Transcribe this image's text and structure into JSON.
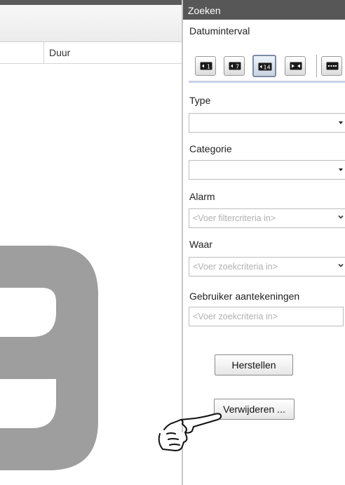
{
  "results_table": {
    "columns": [
      "Duur"
    ]
  },
  "search_panel": {
    "title": "Zoeken",
    "date_interval": {
      "label": "Datuminterval",
      "buttons": [
        {
          "icon": "previous-1-day-icon",
          "glyph": "1",
          "active": false
        },
        {
          "icon": "previous-7-days-icon",
          "glyph": "7",
          "active": false
        },
        {
          "icon": "previous-14-days-icon",
          "glyph": "14",
          "active": true
        },
        {
          "icon": "custom-range-icon",
          "glyph": "",
          "active": false
        },
        {
          "icon": "calendar-icon",
          "glyph": "",
          "active": false
        }
      ]
    },
    "type": {
      "label": "Type",
      "value": ""
    },
    "category": {
      "label": "Categorie",
      "value": ""
    },
    "alarm": {
      "label": "Alarm",
      "placeholder": "<Voer filtercriteria in>"
    },
    "where": {
      "label": "Waar",
      "placeholder": "<Voer zoekcriteria in>"
    },
    "user_notes": {
      "label": "Gebruiker aantekeningen",
      "placeholder": "<Voer zoekcriteria in>"
    },
    "reset_button": "Herstellen",
    "delete_button": "Verwijderen ..."
  },
  "colors": {
    "panel_header": "#575757",
    "active_button_border": "#7a8ba6",
    "watermark": "#9e9e9e"
  }
}
